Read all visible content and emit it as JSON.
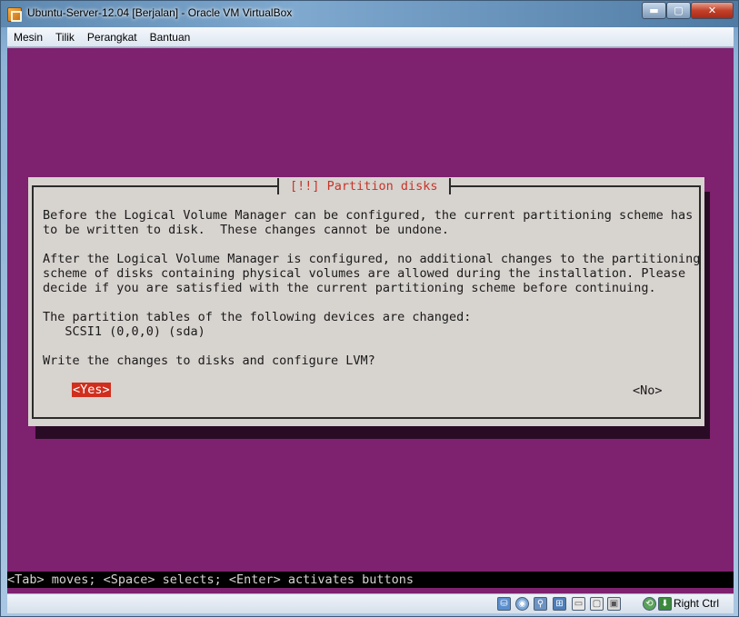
{
  "window": {
    "title": "Ubuntu-Server-12.04 [Berjalan] - Oracle VM VirtualBox",
    "minimize_glyph": "▬",
    "maximize_glyph": "▢",
    "close_glyph": "✕"
  },
  "menubar": {
    "items": [
      {
        "label": "Mesin"
      },
      {
        "label": "Tilik"
      },
      {
        "label": "Perangkat"
      },
      {
        "label": "Bantuan"
      }
    ]
  },
  "dialog": {
    "title": "[!!] Partition disks",
    "lines": [
      "Before the Logical Volume Manager can be configured, the current partitioning scheme has",
      "to be written to disk.  These changes cannot be undone.",
      "After the Logical Volume Manager is configured, no additional changes to the partitioning",
      "scheme of disks containing physical volumes are allowed during the installation. Please",
      "decide if you are satisfied with the current partitioning scheme before continuing.",
      "The partition tables of the following devices are changed:",
      "   SCSI1 (0,0,0) (sda)",
      "Write the changes to disks and configure LVM?"
    ],
    "yes_label": "<Yes>",
    "no_label": "<No>"
  },
  "help_bar": "<Tab> moves; <Space> selects; <Enter> activates buttons",
  "statusbar": {
    "icons": [
      "hard-disk-icon",
      "optical-drive-icon",
      "usb-icon",
      "network-icon",
      "shared-folders-icon",
      "display-icon",
      "video-capture-icon",
      "mouse-integration-icon",
      "host-key-icon"
    ],
    "host_key_label": "Right Ctrl"
  },
  "colors": {
    "screen_background": "#7e216f",
    "dialog_background": "#d7d3cf",
    "dialog_title": "#c7342a",
    "selected_button": "#d02f1e"
  }
}
